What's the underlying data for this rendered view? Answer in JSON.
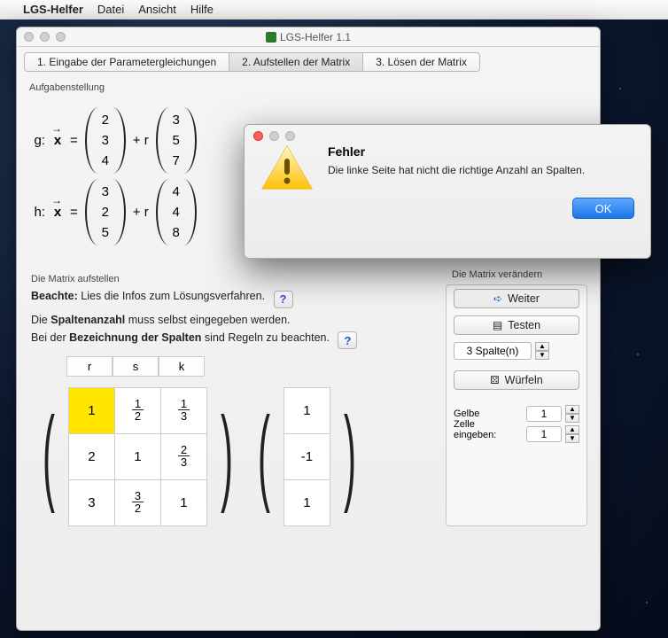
{
  "menubar": {
    "app": "LGS-Helfer",
    "items": [
      "Datei",
      "Ansicht",
      "Hilfe"
    ]
  },
  "window": {
    "title": "LGS-Helfer 1.1"
  },
  "tabs": {
    "t1": "1. Eingabe der Parametergleichungen",
    "t2": "2. Aufstellen der Matrix",
    "t3": "3. Lösen der Matrix"
  },
  "section": {
    "aufgabe": "Aufgabenstellung",
    "aufstellen": "Die Matrix aufstellen",
    "veraendern": "Die Matrix verändern"
  },
  "eq": {
    "g_label": "g:",
    "h_label": "h:",
    "x_sym": "x",
    "equals": "=",
    "plus_r": "+ r",
    "g_a": [
      "2",
      "3",
      "4"
    ],
    "g_b": [
      "3",
      "5",
      "7"
    ],
    "h_a": [
      "3",
      "2",
      "5"
    ],
    "h_b": [
      "4",
      "4",
      "8"
    ]
  },
  "hints": {
    "beachte_label": "Beachte:",
    "beachte_text": " Lies die Infos zum Lösungsverfahren.",
    "spalten1a": "Die ",
    "spalten1b": "Spaltenanzahl",
    "spalten1c": " muss selbst eingegeben werden.",
    "spalten2a": "Bei der ",
    "spalten2b": "Bezeichnung der Spalten",
    "spalten2c": " sind Regeln zu beachten."
  },
  "matrix": {
    "headers": [
      "r",
      "s",
      "k"
    ],
    "cells": [
      [
        "1",
        "1/2",
        "1/3"
      ],
      [
        "2",
        "1",
        "2/3"
      ],
      [
        "3",
        "3/2",
        "1"
      ]
    ],
    "rhs": [
      "1",
      "-1",
      "1"
    ]
  },
  "right": {
    "weiter": "Weiter",
    "testen": "Testen",
    "spalten_value": "3 Spalte(n)",
    "wuerfeln": "Würfeln",
    "gelbe_l1": "Gelbe",
    "gelbe_l2": "Zelle",
    "gelbe_l3": "eingeben:",
    "gelbe_v1": "1",
    "gelbe_v2": "1"
  },
  "alert": {
    "title": "Fehler",
    "message": "Die linke Seite hat nicht die richtige Anzahl an Spalten.",
    "ok": "OK"
  }
}
